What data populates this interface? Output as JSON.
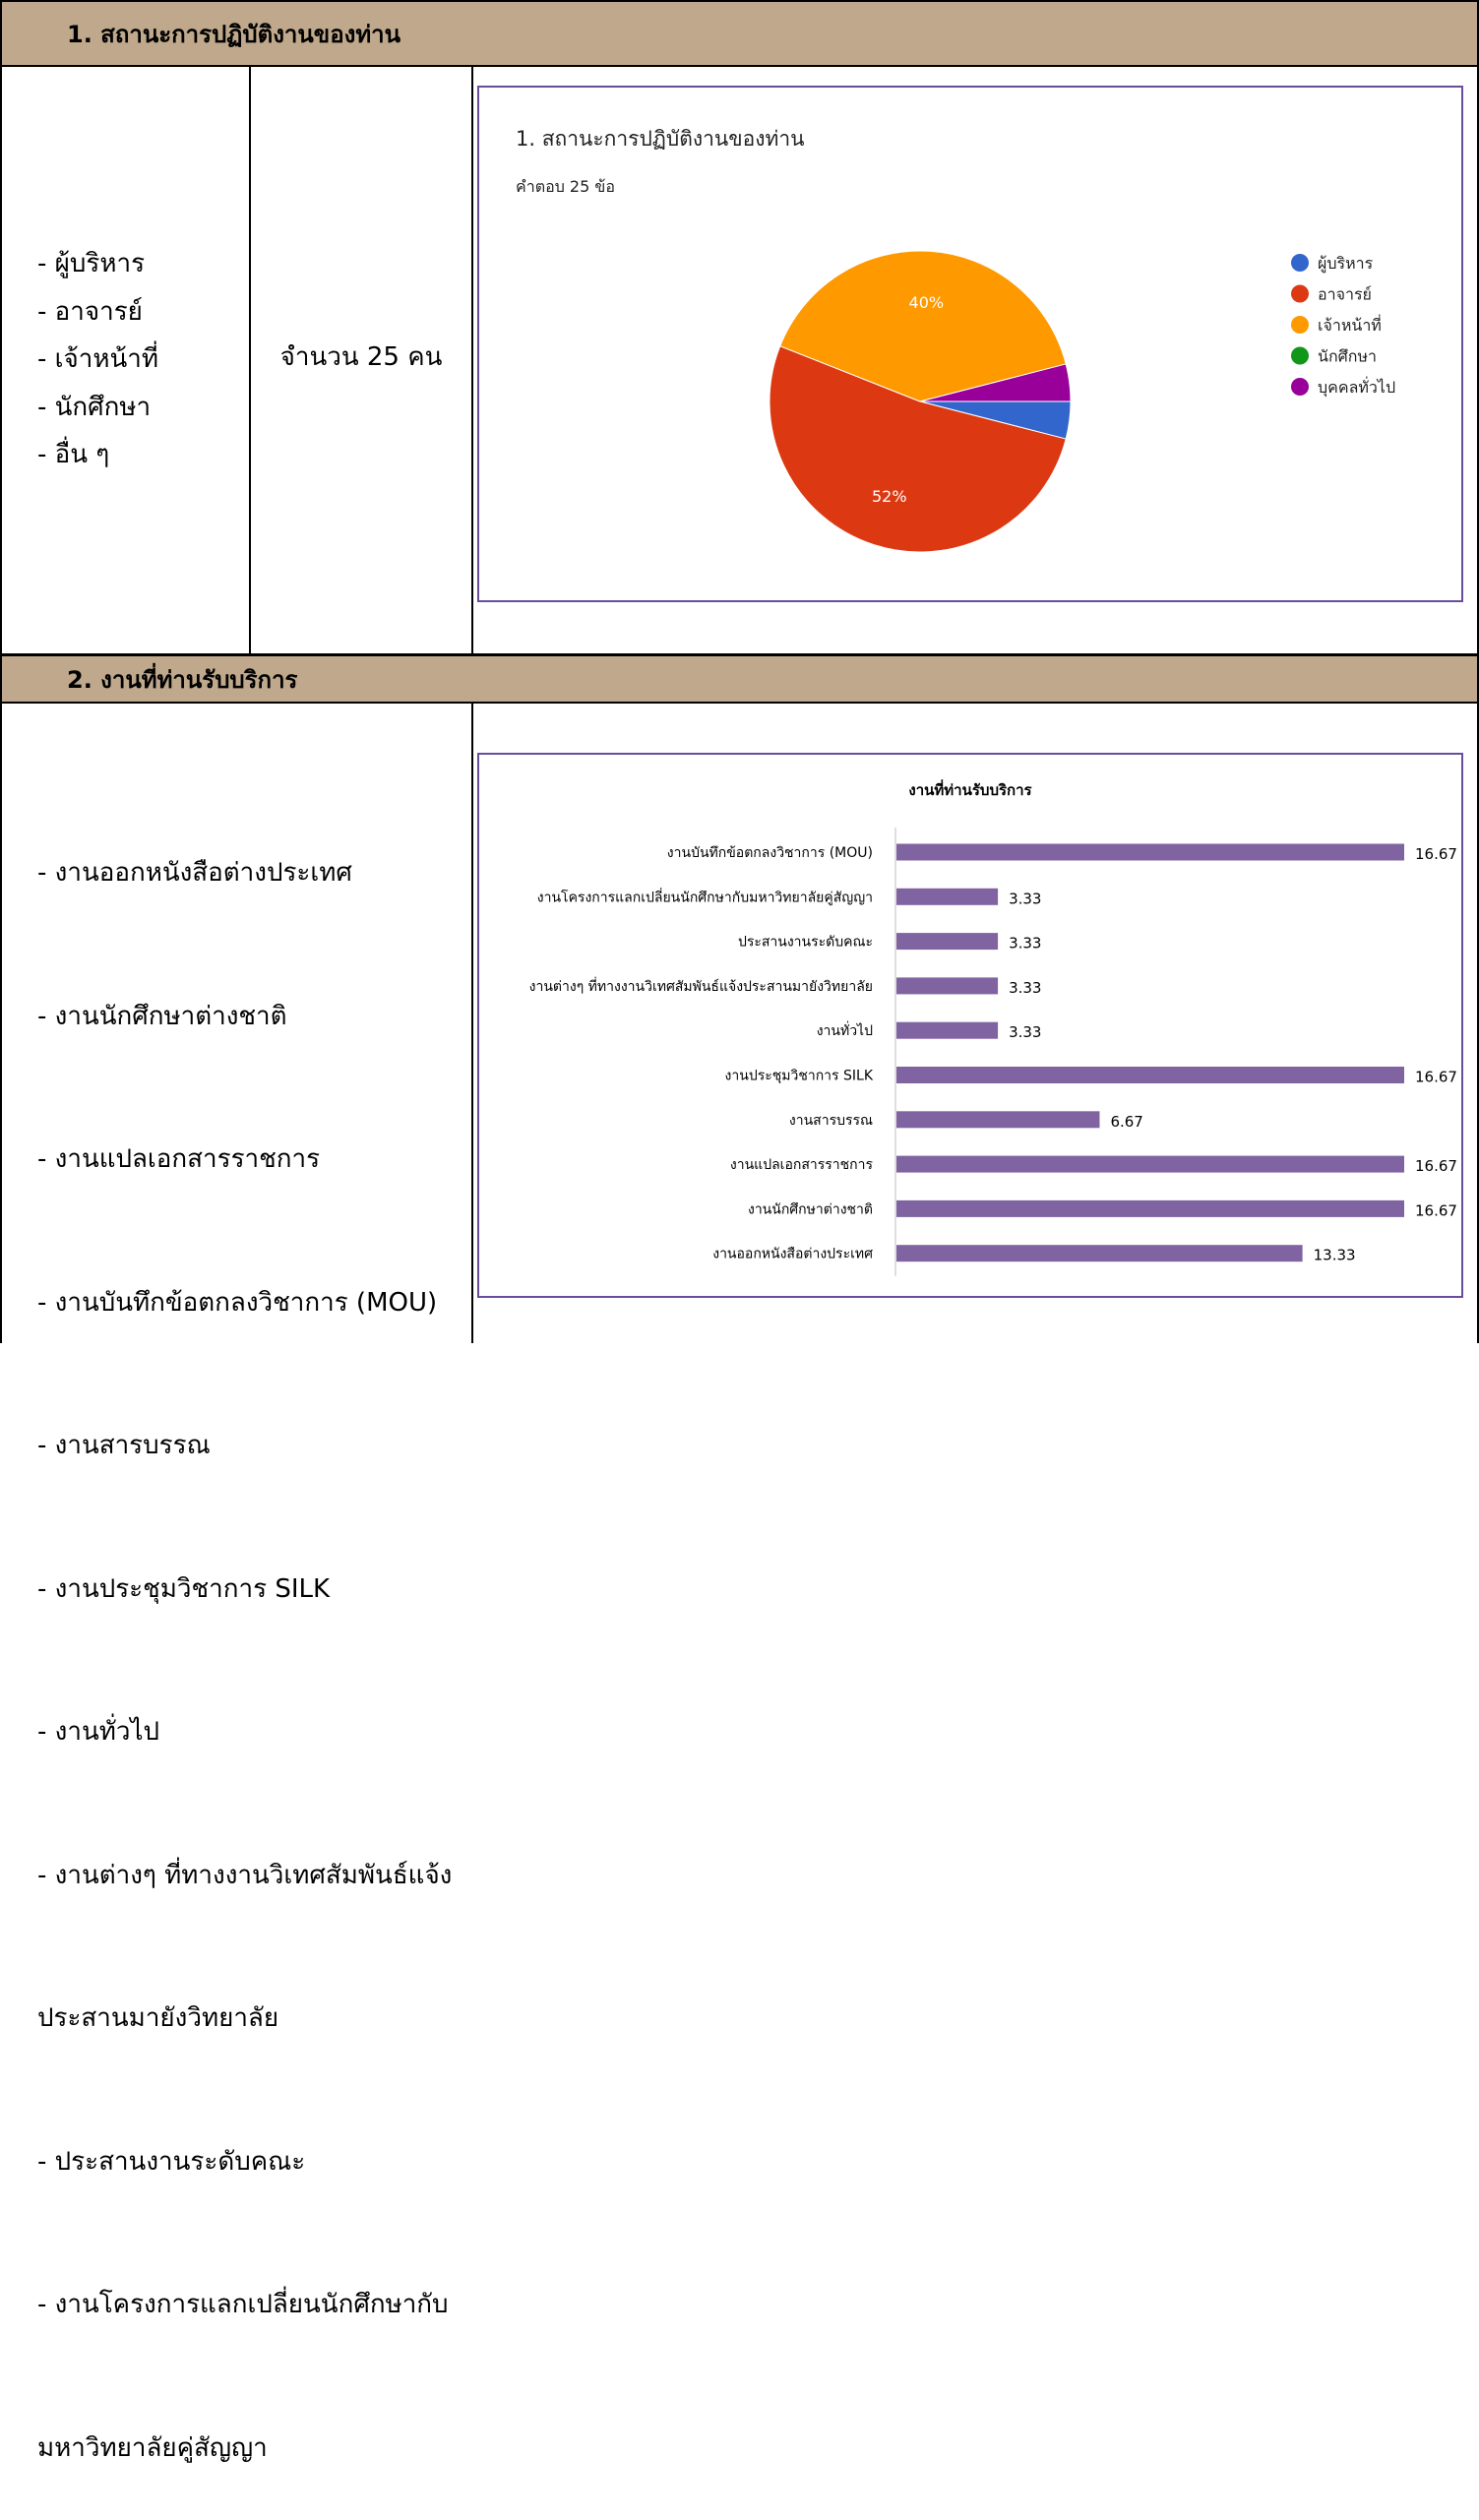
{
  "section1": {
    "header": "1.  สถานะการปฏิบัติงานของท่าน",
    "items": [
      "- ผู้บริหาร",
      "- อาจารย์",
      "- เจ้าหน้าที่",
      "- นักศึกษา",
      "- อื่น ๆ"
    ],
    "count_text": "จำนวน 25 คน"
  },
  "section2": {
    "header": "2.  งานที่ท่านรับบริการ",
    "items": [
      "- งานออกหนังสือต่างประเทศ",
      "- งานนักศึกษาต่างชาติ",
      "- งานแปลเอกสารราชการ",
      "- งานบันทึกข้อตกลงวิชาการ (MOU)",
      "- งานสารบรรณ",
      "- งานประชุมวิชาการ SILK",
      "- งานทั่วไป",
      "- งานต่างๆ ที่ทางงานวิเทศสัมพันธ์แจ้ง",
      "  ประสานมายังวิทยาลัย",
      "- ประสานงานระดับคณะ",
      "- งานโครงการแลกเปลี่ยนนักศึกษากับ",
      "  มหาวิทยาลัยคู่สัญญา"
    ]
  },
  "chart_data": [
    {
      "type": "pie",
      "title": "1. สถานะการปฏิบัติงานของท่าน",
      "subtitle": "คำตอบ 25 ข้อ",
      "legend_position": "right",
      "slices": [
        {
          "name": "ผู้บริหาร",
          "value": 4,
          "color": "#3366cc"
        },
        {
          "name": "อาจารย์",
          "value": 52,
          "color": "#dc3912",
          "label": "52%"
        },
        {
          "name": "เจ้าหน้าที่",
          "value": 40,
          "color": "#ff9900",
          "label": "40%"
        },
        {
          "name": "นักศึกษา",
          "value": 0,
          "color": "#109618"
        },
        {
          "name": "บุคคลทั่วไป",
          "value": 4,
          "color": "#990099"
        }
      ]
    },
    {
      "type": "bar",
      "orientation": "horizontal",
      "title": "งานที่ท่านรับบริการ",
      "bar_color": "#8064a2",
      "xlim": [
        0,
        16.67
      ],
      "categories": [
        "งานบันทึกข้อตกลงวิชาการ (MOU)",
        "งานโครงการแลกเปลี่ยนนักศึกษากับมหาวิทยาลัยคู่สัญญา",
        "ประสานงานระดับคณะ",
        "งานต่างๆ ที่ทางงานวิเทศสัมพันธ์แจ้งประสานมายังวิทยาลัย",
        "งานทั่วไป",
        "งานประชุมวิชาการ SILK",
        "งานสารบรรณ",
        "งานแปลเอกสารราชการ",
        "งานนักศึกษาต่างชาติ",
        "งานออกหนังสือต่างประเทศ"
      ],
      "values": [
        16.67,
        3.33,
        3.33,
        3.33,
        3.33,
        16.67,
        6.67,
        16.67,
        16.67,
        13.33
      ],
      "value_labels": [
        "16.67",
        "3.33",
        "3.33",
        "3.33",
        "3.33",
        "16.67",
        "6.67",
        "16.67",
        "16.67",
        "13.33"
      ]
    }
  ]
}
